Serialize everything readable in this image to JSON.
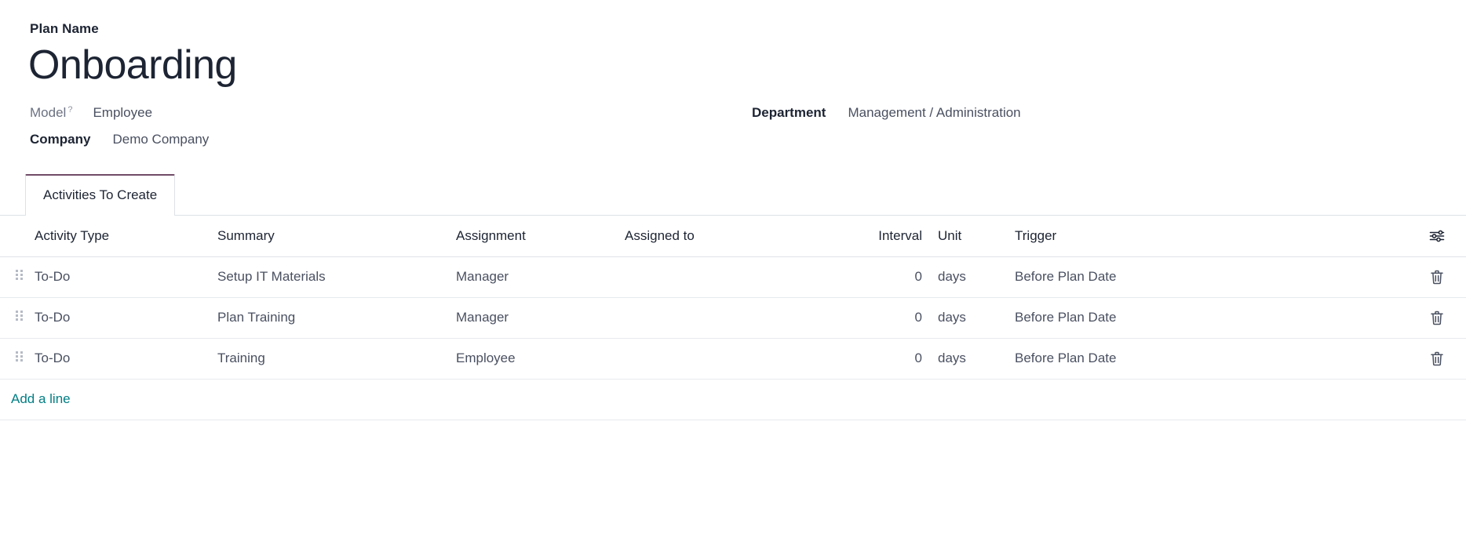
{
  "form": {
    "plan_name_label": "Plan Name",
    "plan_name_value": "Onboarding",
    "fields": [
      {
        "label": "Model",
        "help": "?",
        "value": "Employee"
      },
      {
        "label": "Department",
        "value": "Management / Administration"
      },
      {
        "label": "Company",
        "value": "Demo Company"
      }
    ]
  },
  "notebook": {
    "tabs": [
      {
        "label": "Activities To Create",
        "active": true
      }
    ]
  },
  "table": {
    "columns": [
      {
        "key": "handle",
        "label": ""
      },
      {
        "key": "activity_type",
        "label": "Activity Type"
      },
      {
        "key": "summary",
        "label": "Summary"
      },
      {
        "key": "assignment",
        "label": "Assignment"
      },
      {
        "key": "assigned_to",
        "label": "Assigned to"
      },
      {
        "key": "interval",
        "label": "Interval"
      },
      {
        "key": "unit",
        "label": "Unit"
      },
      {
        "key": "trigger",
        "label": "Trigger"
      },
      {
        "key": "actions",
        "label": ""
      }
    ],
    "rows": [
      {
        "activity_type": "To-Do",
        "summary": "Setup IT Materials",
        "assignment": "Manager",
        "assigned_to": "",
        "interval": "0",
        "unit": "days",
        "trigger": "Before Plan Date"
      },
      {
        "activity_type": "To-Do",
        "summary": "Plan Training",
        "assignment": "Manager",
        "assigned_to": "",
        "interval": "0",
        "unit": "days",
        "trigger": "Before Plan Date"
      },
      {
        "activity_type": "To-Do",
        "summary": "Training",
        "assignment": "Employee",
        "assigned_to": "",
        "interval": "0",
        "unit": "days",
        "trigger": "Before Plan Date"
      }
    ],
    "add_line_label": "Add a line",
    "optional_columns_icon": "sliders-icon",
    "delete_icon": "trash-icon",
    "drag_icon": "drag-handle-icon"
  },
  "colors": {
    "accent": "#714B67",
    "link": "#017e84",
    "text": "#1d2433",
    "muted": "#6c7283",
    "border": "#dee2e6"
  }
}
